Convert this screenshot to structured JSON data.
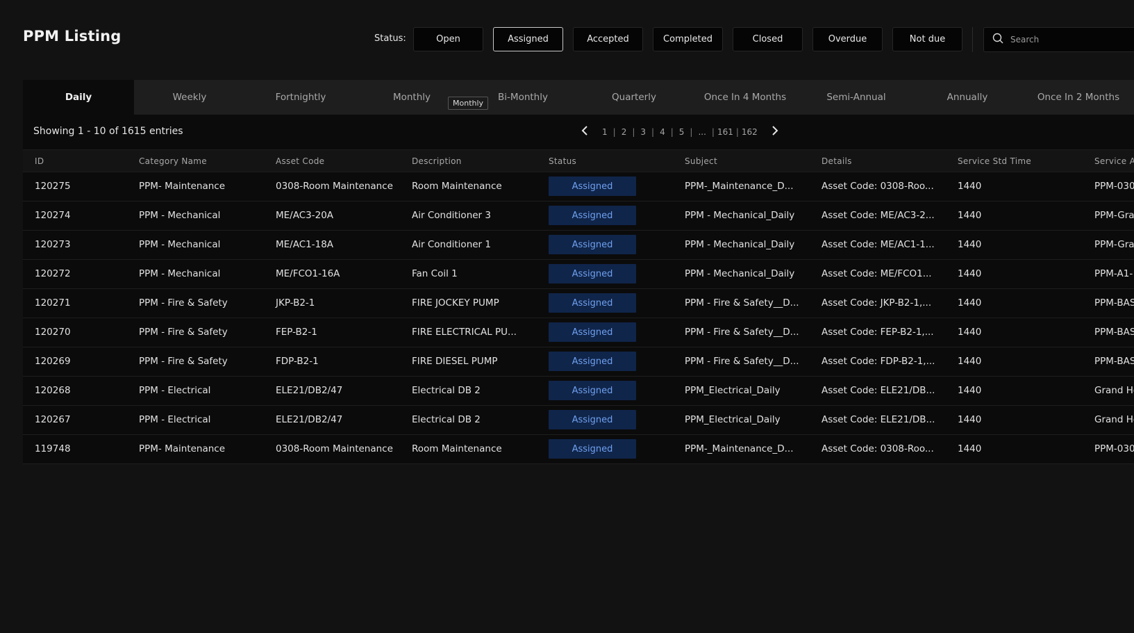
{
  "page_title": "PPM Listing",
  "status_filter": {
    "label": "Status:",
    "buttons": [
      "Open",
      "Assigned",
      "Accepted",
      "Completed",
      "Closed",
      "Overdue",
      "Not due"
    ],
    "active": "Assigned"
  },
  "search": {
    "placeholder": "Search"
  },
  "tabs": [
    "Daily",
    "Weekly",
    "Fortnightly",
    "Monthly",
    "Bi-Monthly",
    "Quarterly",
    "Once In 4 Months",
    "Semi-Annual",
    "Annually",
    "Once In 2 Months"
  ],
  "active_tab": "Daily",
  "tooltip": "Monthly",
  "showing": "Showing 1 - 10 of 1615 entries",
  "pagination": {
    "pages": [
      "1",
      "2",
      "3",
      "4",
      "5",
      "...",
      "161",
      "162"
    ]
  },
  "table": {
    "columns": [
      "ID",
      "Category Name",
      "Asset Code",
      "Description",
      "Status",
      "Subject",
      "Details",
      "Service Std Time",
      "Service A"
    ],
    "rows": [
      [
        "120275",
        "PPM- Maintenance",
        "0308-Room Maintenance",
        "Room Maintenance",
        "Assigned",
        "PPM-_Maintenance_D...",
        "Asset Code: 0308-Roo...",
        "1440",
        "PPM-030"
      ],
      [
        "120274",
        "PPM - Mechanical",
        "ME/AC3-20A",
        "Air Conditioner 3",
        "Assigned",
        "PPM - Mechanical_Daily",
        "Asset Code: ME/AC3-2...",
        "1440",
        "PPM-Gra"
      ],
      [
        "120273",
        "PPM - Mechanical",
        "ME/AC1-18A",
        "Air Conditioner 1",
        "Assigned",
        "PPM - Mechanical_Daily",
        "Asset Code: ME/AC1-1...",
        "1440",
        "PPM-Gra"
      ],
      [
        "120272",
        "PPM - Mechanical",
        "ME/FCO1-16A",
        "Fan Coil 1",
        "Assigned",
        "PPM - Mechanical_Daily",
        "Asset Code: ME/FCO1...",
        "1440",
        "PPM-A1-"
      ],
      [
        "120271",
        "PPM - Fire & Safety",
        "JKP-B2-1",
        "FIRE JOCKEY PUMP",
        "Assigned",
        "PPM - Fire & Safety__D...",
        "Asset Code: JKP-B2-1,...",
        "1440",
        "PPM-BAS"
      ],
      [
        "120270",
        "PPM - Fire & Safety",
        "FEP-B2-1",
        "FIRE ELECTRICAL PU...",
        "Assigned",
        "PPM - Fire & Safety__D...",
        "Asset Code: FEP-B2-1,...",
        "1440",
        "PPM-BAS"
      ],
      [
        "120269",
        "PPM - Fire & Safety",
        "FDP-B2-1",
        "FIRE DIESEL PUMP",
        "Assigned",
        "PPM - Fire & Safety__D...",
        "Asset Code: FDP-B2-1,...",
        "1440",
        "PPM-BAS"
      ],
      [
        "120268",
        "PPM - Electrical",
        "ELE21/DB2/47",
        "Electrical DB 2",
        "Assigned",
        "PPM_Electrical_Daily",
        "Asset Code: ELE21/DB...",
        "1440",
        "Grand Ho"
      ],
      [
        "120267",
        "PPM - Electrical",
        "ELE21/DB2/47",
        "Electrical DB 2",
        "Assigned",
        "PPM_Electrical_Daily",
        "Asset Code: ELE21/DB...",
        "1440",
        "Grand Ho"
      ],
      [
        "119748",
        "PPM- Maintenance",
        "0308-Room Maintenance",
        "Room Maintenance",
        "Assigned",
        "PPM-_Maintenance_D...",
        "Asset Code: 0308-Roo...",
        "1440",
        "PPM-030"
      ]
    ]
  },
  "colors": {
    "background": "#121212",
    "badge_bg": "#10254a",
    "badge_text": "#6ea0ef"
  },
  "icons": {
    "search": "search-icon",
    "prev": "chevron-left-icon",
    "next": "chevron-right-icon"
  }
}
